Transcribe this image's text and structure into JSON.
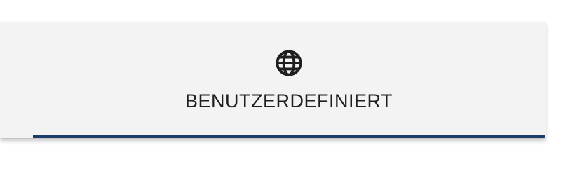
{
  "tabs": [
    {
      "label": "BENUTZERDEFINIERT",
      "icon": "globe-icon",
      "selected": true
    }
  ],
  "colors": {
    "tab_background": "#f3f3f3",
    "active_indicator": "#1b3d6b",
    "text": "#1f1f1f"
  }
}
